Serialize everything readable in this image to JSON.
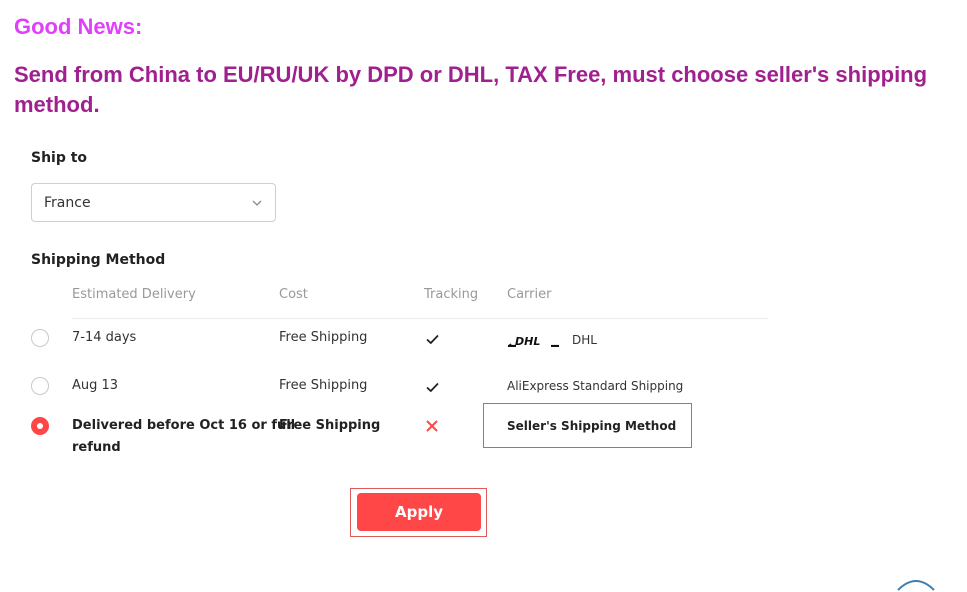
{
  "headline": {
    "good_news": "Good News:",
    "main": "Send from China to EU/RU/UK by DPD or DHL, TAX Free, must choose seller's shipping method."
  },
  "ship_to": {
    "label": "Ship to",
    "selected_country": "France"
  },
  "shipping_method": {
    "label": "Shipping Method",
    "columns": [
      "Estimated Delivery",
      "Cost",
      "Tracking",
      "Carrier"
    ],
    "rows": [
      {
        "delivery": "7-14 days",
        "cost": "Free Shipping",
        "tracking": "check",
        "carrier": "DHL",
        "carrier_logo": "DHL",
        "selected": false
      },
      {
        "delivery": "Aug 13",
        "cost": "Free Shipping",
        "tracking": "check",
        "carrier": "AliExpress Standard Shipping",
        "selected": false
      },
      {
        "delivery_line1": "Delivered before Oct 16 or full",
        "delivery_line2": "refund",
        "cost": "Free Shipping",
        "tracking": "x",
        "carrier": "Seller's Shipping Method",
        "selected": true
      }
    ]
  },
  "apply_label": "Apply",
  "colors": {
    "accent": "#ff4747",
    "headline_good": "#e040fb",
    "headline_main": "#a0208f",
    "highlight_border": "#e05a5a"
  }
}
